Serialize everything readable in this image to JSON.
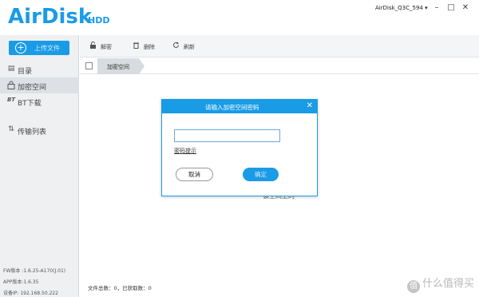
{
  "app": {
    "logo_main": "AirDisk",
    "logo_sub": "HDD",
    "device_name": "AirDisk_Q3C_594 ▾",
    "window_controls": {
      "minimize": "–",
      "maximize": "□",
      "close": "✕"
    }
  },
  "sidebar": {
    "upload_label": "上传文件",
    "items": [
      {
        "label": "目录",
        "icon": "folder-list-icon",
        "glyph": "▤"
      },
      {
        "label": "加密空间",
        "icon": "lock-icon",
        "glyph": "🔒"
      },
      {
        "label": "BT下载",
        "icon": "bt-icon",
        "glyph": "BT"
      },
      {
        "label": "传输列表",
        "icon": "transfer-icon",
        "glyph": "⇅"
      }
    ],
    "info": {
      "fw": "FW版本 :1.6.25-A170(J.01)",
      "app": "APP版本:1.6.35",
      "ip": "设备IP: 192.168.50.222"
    }
  },
  "toolbar": {
    "decrypt": "解密",
    "delete": "删除",
    "refresh": "刷新"
  },
  "tabbar": {
    "current_tab": "加密空间"
  },
  "main": {
    "empty_text": "该空间上的",
    "status": "文件总数：0，已获取数：0"
  },
  "dialog": {
    "title": "请输入加密空间密码",
    "close": "✕",
    "input_value": "",
    "hint_link": "密码提示",
    "cancel_label": "取消",
    "ok_label": "确定"
  },
  "watermark": {
    "badge": "值",
    "text": "什么值得买"
  },
  "colors": {
    "accent": "#1a9be6",
    "sidebar_bg": "#eef0f2",
    "toolbar_bg": "#f4f5f6"
  }
}
